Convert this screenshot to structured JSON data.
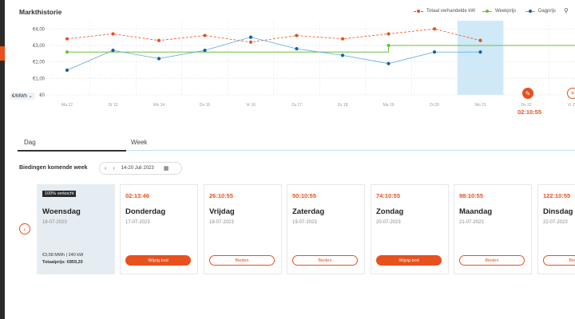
{
  "title": "Markthistorie",
  "legend": {
    "total": "Totaal verhandelde kW",
    "week": "Weekprijs",
    "day": "Dagprijs"
  },
  "unit_selector": "€/MWh",
  "chart_time": "02:10:55",
  "colors": {
    "accent": "#e8501e",
    "week_line": "#6cbf3d",
    "day_line": "#5aa8e0",
    "day_point": "#1a5fa0",
    "highlight": "#cfe9f8"
  },
  "icons": {
    "zoom": "search-icon",
    "edit": "edit-icon",
    "add": "plus-icon",
    "prev": "chevron-left-icon",
    "calendar": "calendar-icon"
  },
  "chart_data": {
    "type": "line",
    "categories": [
      "Ma 12",
      "Di 13",
      "Wo 14",
      "Do 15",
      "Vr 16",
      "Za 17",
      "Zo 18",
      "Ma 19",
      "Di 20",
      "Wo 21",
      "Do 22",
      "Vr 23"
    ],
    "y_ticks": [
      "€0",
      "€1,00",
      "€2,00",
      "€3,00",
      "€4,00"
    ],
    "ylim": [
      0,
      4.4
    ],
    "highlight_category": "Wo 21",
    "series": [
      {
        "name": "Totaal verhandelde kW",
        "style": "dashed",
        "values": [
          3.4,
          3.7,
          3.3,
          3.6,
          3.2,
          3.6,
          3.4,
          3.7,
          4.0,
          3.3,
          null,
          null
        ]
      },
      {
        "name": "Weekprijs",
        "style": "solid",
        "values": [
          2.6,
          2.6,
          2.6,
          2.6,
          2.6,
          2.6,
          2.6,
          3.0,
          3.0,
          3.0,
          3.0,
          3.0
        ]
      },
      {
        "name": "Dagprijs",
        "style": "solid",
        "values": [
          1.5,
          2.7,
          2.2,
          2.7,
          3.5,
          2.8,
          2.4,
          1.9,
          2.6,
          2.6,
          null,
          null
        ]
      }
    ]
  },
  "tabs": {
    "day": "Dag",
    "week": "Week"
  },
  "bids": {
    "label": "Biedingen komende week",
    "week_range": "14-20 Juli 2023",
    "prev_arrow": "‹",
    "next_arrow": "›"
  },
  "cards": [
    {
      "sold": true,
      "badge": "100% verkocht",
      "day": "Woensdag",
      "date": "16-07-2023",
      "line1": "€3,58 MWh  |  240 kW",
      "line2": "Totaalprijs: €859,20"
    },
    {
      "time": "02:13:46",
      "day": "Donderdag",
      "date": "17-07-2023",
      "button": "Wijzig bod",
      "button_style": "filled"
    },
    {
      "time": "26:10:55",
      "day": "Vrijdag",
      "date": "18-07-2023",
      "button": "Bieden",
      "button_style": "outline"
    },
    {
      "time": "50:10:55",
      "day": "Zaterdag",
      "date": "19-07-2023",
      "button": "Bieden",
      "button_style": "outline"
    },
    {
      "time": "74:10:55",
      "day": "Zondag",
      "date": "20-07-2023",
      "button": "Wijzig bod",
      "button_style": "filled"
    },
    {
      "time": "98:10:55",
      "day": "Maandag",
      "date": "21-07-2023",
      "button": "Bieden",
      "button_style": "outline"
    },
    {
      "time": "122:10:55",
      "day": "Dinsdag",
      "date": "22-07-2023",
      "button": "Bieden",
      "button_style": "outline"
    }
  ]
}
